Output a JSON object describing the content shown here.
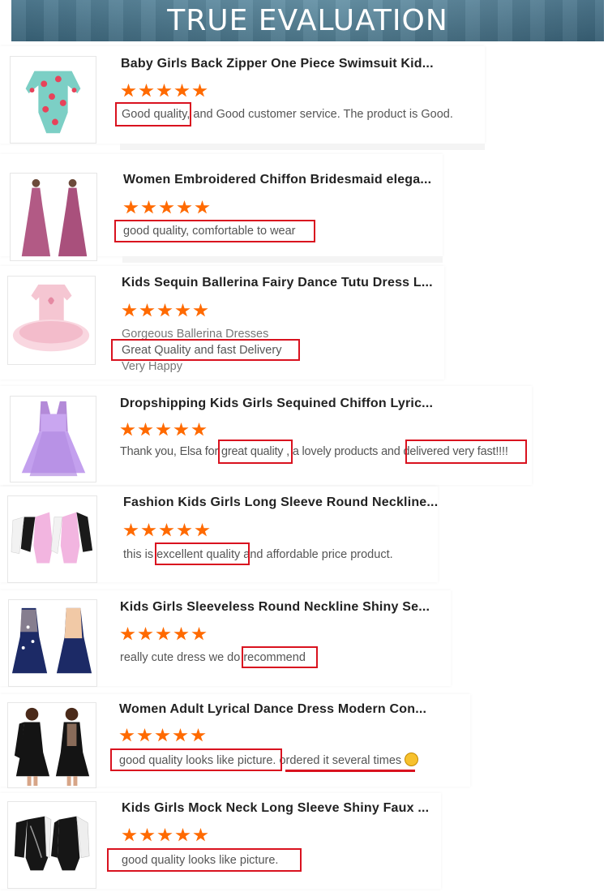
{
  "header": {
    "title": "TRUE EVALUATION"
  },
  "colors": {
    "star": "#ff6a00",
    "highlight": "#d9121f",
    "banner": "#4d7a91"
  },
  "reviews": [
    {
      "title": "Baby Girls Back Zipper One Piece Swimsuit Kid...",
      "rating": 5,
      "lines": [
        "Good quality, and Good customer service. The product is Good."
      ],
      "highlights": [
        "Good quality"
      ]
    },
    {
      "title": "Women Embroidered Chiffon Bridesmaid elega...",
      "rating": 5,
      "lines": [
        "good quality, comfortable to wear"
      ],
      "highlights": [
        "good quality, comfortable to wear"
      ]
    },
    {
      "title": "Kids Sequin Ballerina Fairy Dance Tutu Dress L...",
      "rating": 5,
      "lines": [
        "Gorgeous Ballerina Dresses",
        "Great Quality and fast Delivery",
        "Very Happy"
      ],
      "highlights": [
        "Great Quality and fast Delivery"
      ]
    },
    {
      "title": "Dropshipping Kids Girls Sequined Chiffon Lyric...",
      "rating": 5,
      "lines": [
        "Thank you, Elsa for great quality , a lovely products and delivered very fast!!!!"
      ],
      "highlights": [
        "great quality",
        "delivered very fast!!!!"
      ]
    },
    {
      "title": "Fashion Kids Girls Long Sleeve Round Neckline...",
      "rating": 5,
      "lines": [
        "this is excellent quality and affordable price product."
      ],
      "highlights": [
        "excellent quality"
      ]
    },
    {
      "title": "Kids Girls Sleeveless Round Neckline Shiny Se...",
      "rating": 5,
      "lines": [
        "really cute dress we do recommend"
      ],
      "highlights": [
        "recommend"
      ]
    },
    {
      "title": "Women Adult Lyrical Dance Dress Modern Con...",
      "rating": 5,
      "lines": [
        "good quality looks like picture. ordered it  several times"
      ],
      "highlights": [
        "good quality looks like picture.",
        "ordered it  several times"
      ],
      "emoji": "smile-emoji"
    },
    {
      "title": "Kids Girls Mock Neck Long Sleeve Shiny Faux ...",
      "rating": 5,
      "lines": [
        "good quality looks like picture."
      ],
      "highlights": [
        "good quality looks like picture."
      ]
    }
  ]
}
